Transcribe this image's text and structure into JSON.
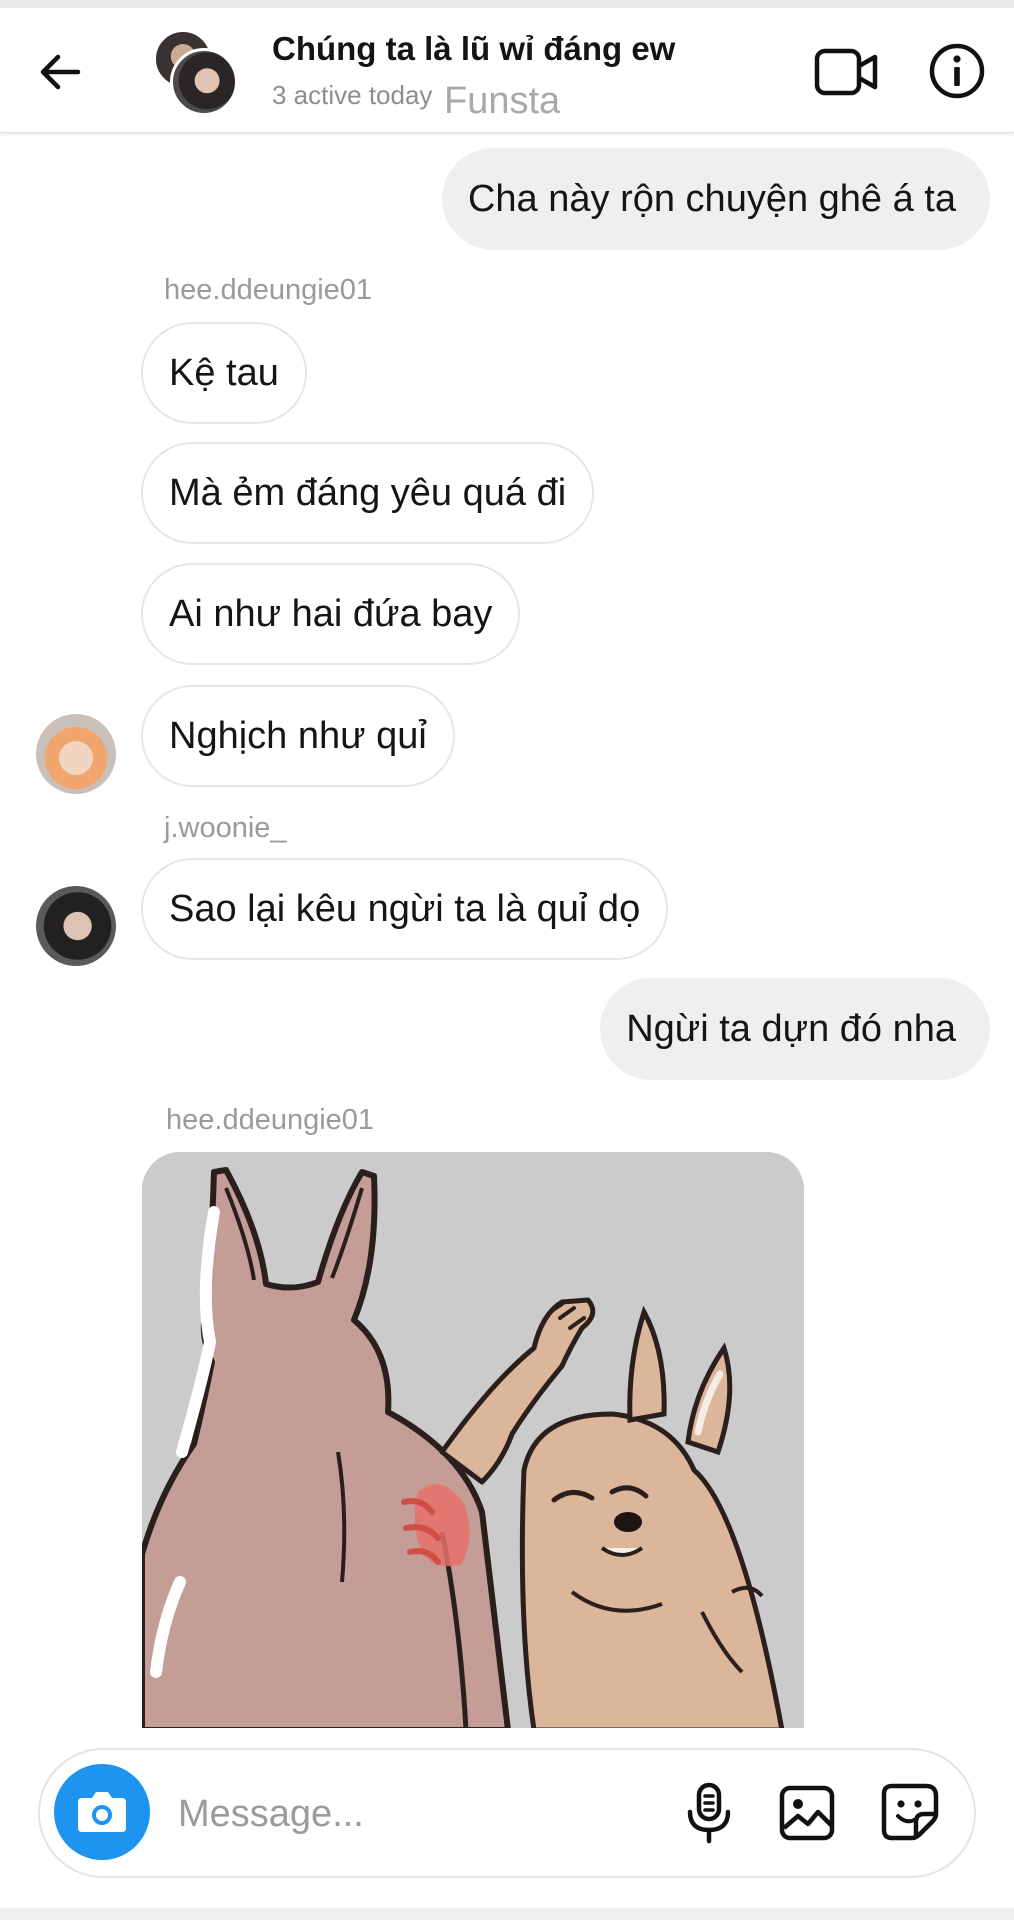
{
  "header": {
    "title": "Chúng ta là lũ wỉ đáng ew",
    "subtitle": "3 active today",
    "watermark": "Funsta",
    "icons": [
      "back-arrow-icon",
      "video-call-icon",
      "info-icon"
    ]
  },
  "messages": [
    {
      "type": "outgoing",
      "text": "Cha này rộn chuyện ghê á ta"
    },
    {
      "type": "sender_label",
      "text": "hee.ddeungie01"
    },
    {
      "type": "incoming",
      "text": "Kệ tau"
    },
    {
      "type": "incoming",
      "text": "Mà ẻm đáng yêu quá đi"
    },
    {
      "type": "incoming",
      "text": "Ai như hai đứa bay"
    },
    {
      "type": "incoming",
      "text": "Nghịch như quỉ"
    },
    {
      "type": "sender_label",
      "text": "j.woonie_"
    },
    {
      "type": "incoming",
      "text": "Sao lại kêu ngừi ta là quỉ dọ"
    },
    {
      "type": "outgoing",
      "text": "Ngừi ta dựn đó nha"
    },
    {
      "type": "sender_label",
      "text": "hee.ddeungie01"
    },
    {
      "type": "sticker",
      "description": "rabbit-slap-sticker"
    }
  ],
  "composer": {
    "placeholder": "Message...",
    "icons": [
      "camera-icon",
      "microphone-icon",
      "gallery-icon",
      "sticker-icon"
    ]
  },
  "colors": {
    "accent": "#1d94ef",
    "outgoing_bubble": "#efefef",
    "incoming_border": "#e6e6e6",
    "meta_text": "#9a9a9a"
  }
}
